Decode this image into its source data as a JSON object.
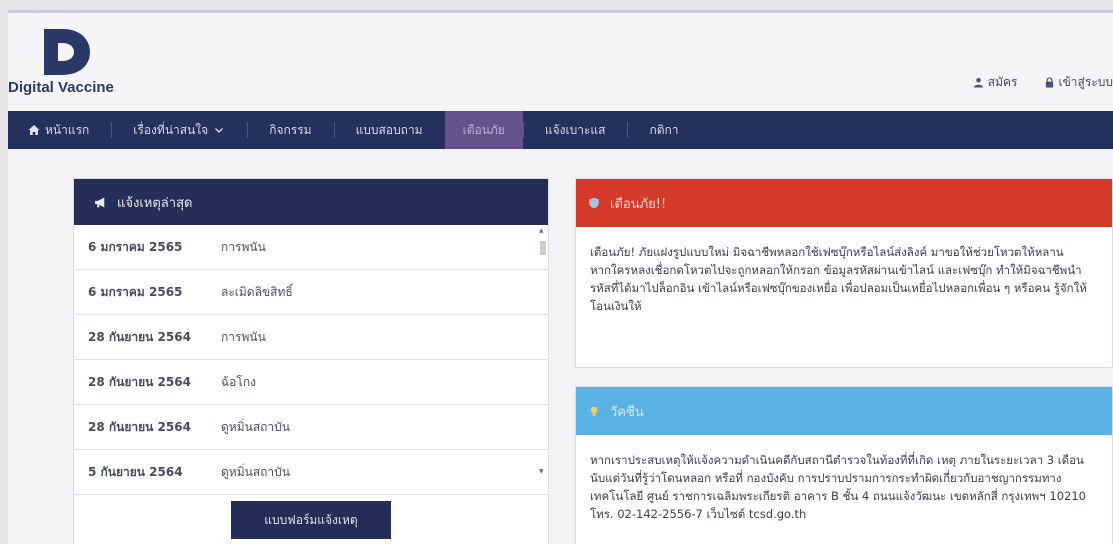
{
  "brand": {
    "name": "Digital Vaccine"
  },
  "top_links": [
    {
      "label": "สมัคร",
      "icon": "user-icon"
    },
    {
      "label": "เข้าสู่ระบบ",
      "icon": "lock-icon"
    }
  ],
  "nav": {
    "items": [
      {
        "label": "หน้าแรก",
        "icon": "home-icon"
      },
      {
        "label": "เรื่องที่น่าสนใจ",
        "icon": "chevron-down-icon"
      },
      {
        "label": "กิจกรรม"
      },
      {
        "label": "แบบสอบถาม"
      },
      {
        "label": "เตือนภัย",
        "active": true
      },
      {
        "label": "แจ้งเบาะแส"
      },
      {
        "label": "กติกา"
      }
    ]
  },
  "incidents": {
    "title": "แจ้งเหตุล่าสุด",
    "rows": [
      {
        "date": "6 มกราคม 2565",
        "type": "การพนัน"
      },
      {
        "date": "6 มกราคม 2565",
        "type": "ละเมิดลิขสิทธิ์"
      },
      {
        "date": "28 กันยายน 2564",
        "type": "การพนัน"
      },
      {
        "date": "28 กันยายน 2564",
        "type": "ฉ้อโกง"
      },
      {
        "date": "28 กันยายน 2564",
        "type": "ดูหมิ่นสถาบัน"
      },
      {
        "date": "5 กันยายน 2564",
        "type": "ดูหมิ่นสถาบัน"
      }
    ],
    "report_button": "แบบฟอร์มแจ้งเหตุ"
  },
  "warning": {
    "title": "เตือนภัย!!",
    "body": "เตือนภัย! ภัยแฝงรูปแบบใหม่ มิจฉาชีพหลอกใช้เฟซบุ๊กหรือไลน์ส่งลิงค์ มาขอให้ช่วยโหวตให้หลาน หากใครหลงเชื่อกดโหวตไปจะถูกหลอกให้กรอก ข้อมูลรหัสผ่านเข้าไลน์ และเฟซบุ๊ก ทำให้มิจฉาชีพนำรหัสที่ได้มาไปล็อกอิน เข้าไลน์หรือเฟซบุ๊กของเหยื่อ เพื่อปลอมเป็นเหยื่อไปหลอกเพื่อน ๆ หรือคน รู้จักให้โอนเงินให้",
    "color": "#d33a2a"
  },
  "advice": {
    "title": "วัคซีน",
    "body": "หากเราประสบเหตุให้แจ้งความดำเนินคดีกับสถานีตำรวจในท้องที่ที่เกิด เหตุ ภายในระยะเวลา 3 เดือน นับแต่วันที่รู้ว่าโดนหลอก หรือที่ กองบังคับ การปราบปรามการกระทำผิดเกี่ยวกับอาชญากรรมทางเทคโนโลยี ศูนย์ ราชการเฉลิมพระเกียรติ อาคาร B ชั้น 4 ถนนแจ้งวัฒนะ เขตหลักสี่ กรุงเทพฯ 10210 โทร. 02-142-2556-7 เว็บไซต์ tcsd.go.th",
    "color": "#5ab1e4"
  },
  "colors": {
    "navy": "#25305c",
    "active_nav": "#66528a"
  }
}
